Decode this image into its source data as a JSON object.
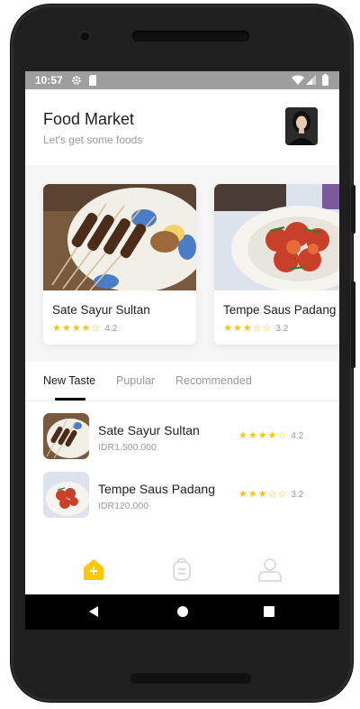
{
  "status_bar": {
    "time": "10:57",
    "icons": [
      "gear-icon",
      "sd-card-icon",
      "wifi-icon",
      "signal-icon",
      "battery-icon"
    ]
  },
  "header": {
    "title": "Food Market",
    "subtitle": "Let's get some foods"
  },
  "featured": [
    {
      "name": "Sate Sayur Sultan",
      "rating": 4.2,
      "rating_label": "4.2",
      "stars": 4
    },
    {
      "name": "Tempe Saus Padang",
      "rating": 3.2,
      "rating_label": "3.2",
      "stars": 3
    }
  ],
  "tabs": [
    {
      "label": "New Taste",
      "active": true
    },
    {
      "label": "Pupular",
      "active": false
    },
    {
      "label": "Recommended",
      "active": false
    }
  ],
  "list": [
    {
      "name": "Sate Sayur Sultan",
      "price": "IDR1.500.000",
      "rating_label": "4.2",
      "stars": 4
    },
    {
      "name": "Tempe Saus Padang",
      "price": "IDR120.000",
      "rating_label": "3.2",
      "stars": 3
    }
  ],
  "bottom_nav": [
    {
      "icon": "home-icon",
      "active": true
    },
    {
      "icon": "order-icon",
      "active": false
    },
    {
      "icon": "profile-icon",
      "active": false
    }
  ],
  "colors": {
    "accent": "#FFC700",
    "star": "#F8C50C",
    "text": "#1E1E1E",
    "muted": "#9A9A9A"
  }
}
